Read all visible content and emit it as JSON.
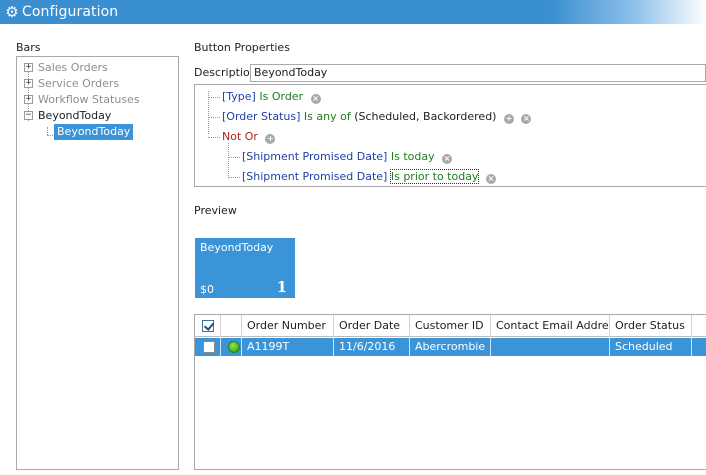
{
  "window": {
    "title": "Configuration",
    "icon": "gear-icon"
  },
  "sections": {
    "bars": "Bars",
    "button_properties": "Button Properties",
    "preview": "Preview"
  },
  "tree": {
    "items": [
      {
        "label": "Sales Orders",
        "expander": "+",
        "disabled": true
      },
      {
        "label": "Service Orders",
        "expander": "+",
        "disabled": true
      },
      {
        "label": "Workflow Statuses",
        "expander": "+",
        "disabled": true
      },
      {
        "label": "BeyondToday",
        "expander": "−",
        "disabled": false
      },
      {
        "label": "BeyondToday",
        "selected": true
      }
    ]
  },
  "description": {
    "label": "Description",
    "value": "BeyondToday"
  },
  "filter": {
    "conditions": [
      {
        "field": "[Type]",
        "operator": "Is Order",
        "value": ""
      },
      {
        "field": "[Order Status]",
        "operator": "Is any of",
        "value": "(Scheduled, Backordered)"
      },
      {
        "group": "Not Or"
      },
      {
        "field": "[Shipment Promised Date]",
        "operator": "Is today",
        "value": ""
      },
      {
        "field": "[Shipment Promised Date]",
        "operator": "Is prior to today",
        "value": ""
      }
    ],
    "add_glyph": "+",
    "remove_glyph": "×"
  },
  "preview_tile": {
    "name": "BeyondToday",
    "amount": "$0",
    "count": "1",
    "color": "#3b94d8"
  },
  "grid": {
    "columns": [
      "",
      "",
      "Order Number",
      "Order Date",
      "Customer ID",
      "Contact Email Address",
      "Order Status"
    ],
    "rows": [
      {
        "order_number": "A1199T",
        "order_date": "11/6/2016",
        "customer_id": "Abercrombie",
        "contact_email": "",
        "order_status": "Scheduled"
      }
    ]
  },
  "colors": {
    "accent": "#3b94d8",
    "titlebar": "#3a8fd1",
    "field": "#1f3fa8",
    "operator": "#1e7d1e",
    "group": "#b21f1f"
  }
}
